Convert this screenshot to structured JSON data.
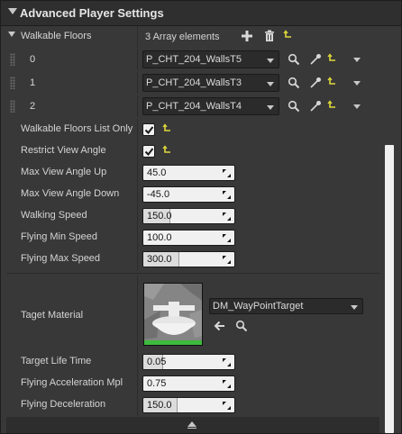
{
  "header": {
    "title": "Advanced Player Settings"
  },
  "walkable_floors": {
    "label": "Walkable Floors",
    "count_text": "3 Array elements",
    "items": [
      {
        "index": "0",
        "value": "P_CHT_204_WallsT5"
      },
      {
        "index": "1",
        "value": "P_CHT_204_WallsT3"
      },
      {
        "index": "2",
        "value": "P_CHT_204_WallsT4"
      }
    ]
  },
  "walkable_floors_list_only": {
    "label": "Walkable Floors List Only",
    "checked": true
  },
  "restrict_view_angle": {
    "label": "Restrict View Angle",
    "checked": true
  },
  "max_view_angle_up": {
    "label": "Max View Angle Up",
    "value": "45.0"
  },
  "max_view_angle_down": {
    "label": "Max View Angle Down",
    "value": "-45.0"
  },
  "walking_speed": {
    "label": "Walking Speed",
    "value": "150.0",
    "fill": 0.3
  },
  "flying_min_speed": {
    "label": "Flying Min Speed",
    "value": "100.0"
  },
  "flying_max_speed": {
    "label": "Flying Max Speed",
    "value": "300.0",
    "fill": 0.4
  },
  "target_material": {
    "label": "Taget Material",
    "asset": "DM_WayPointTarget"
  },
  "target_life_time": {
    "label": "Target Life Time",
    "value": "0.05",
    "fill": 0.22
  },
  "flying_acceleration_mpl": {
    "label": "Flying Acceleration Mpl",
    "value": "0.75"
  },
  "flying_deceleration": {
    "label": "Flying Deceleration",
    "value": "150.0",
    "fill": 0.38
  },
  "colors": {
    "reset_arrow": "#e0d83a",
    "thumbnail_bar": "#3dbb3d"
  }
}
